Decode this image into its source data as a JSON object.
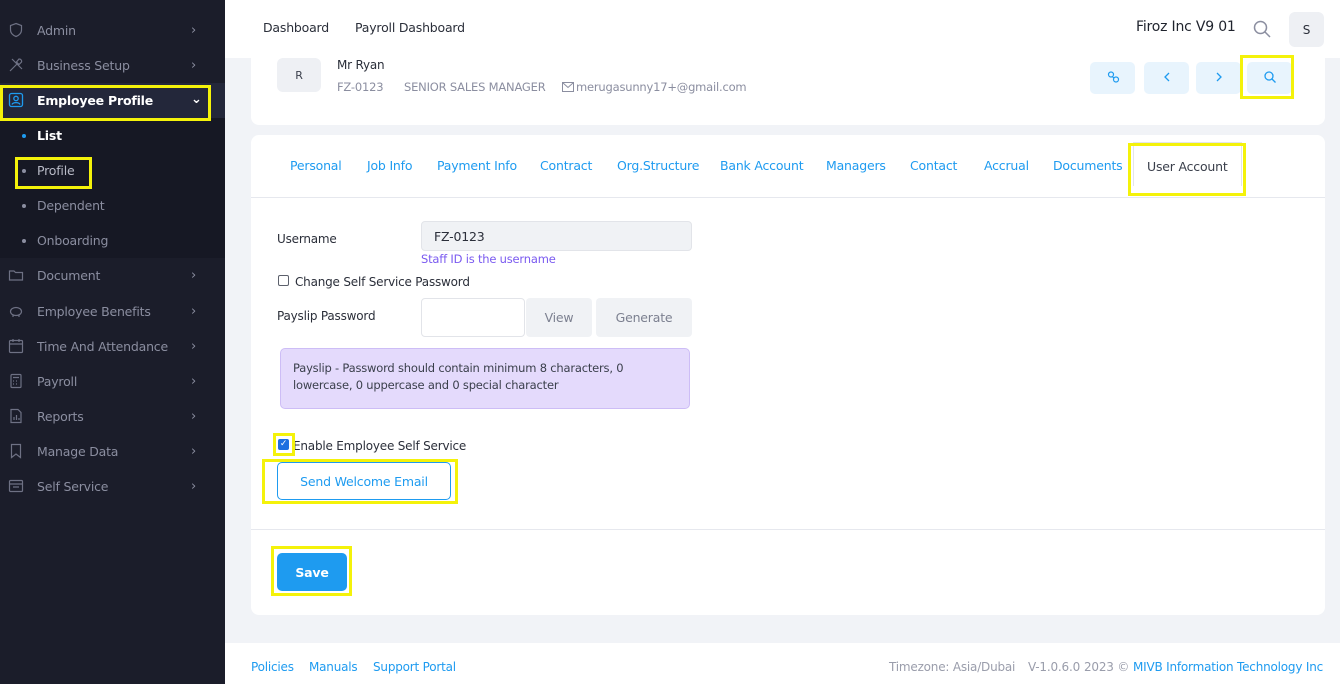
{
  "sidebar": {
    "items": [
      {
        "label": "Admin",
        "icon": "shield-icon"
      },
      {
        "label": "Business Setup",
        "icon": "tools-icon"
      },
      {
        "label": "Employee Profile",
        "icon": "user-card-icon"
      },
      {
        "label": "Document",
        "icon": "folder-icon"
      },
      {
        "label": "Employee Benefits",
        "icon": "piggy-bank-icon"
      },
      {
        "label": "Time And Attendance",
        "icon": "calendar-icon"
      },
      {
        "label": "Payroll",
        "icon": "calculator-icon"
      },
      {
        "label": "Reports",
        "icon": "report-icon"
      },
      {
        "label": "Manage Data",
        "icon": "bookmark-icon"
      },
      {
        "label": "Self Service",
        "icon": "inbox-icon"
      }
    ],
    "sub_items": [
      {
        "label": "List"
      },
      {
        "label": "Profile"
      },
      {
        "label": "Dependent"
      },
      {
        "label": "Onboarding"
      }
    ]
  },
  "header": {
    "links": [
      "Dashboard",
      "Payroll Dashboard"
    ],
    "company": "Firoz Inc V9 01",
    "avatar_initial": "S"
  },
  "employee": {
    "initial": "R",
    "name": "Mr Ryan",
    "staff_id": "FZ-0123",
    "title": "SENIOR SALES MANAGER",
    "email": "merugasunny17+@gmail.com"
  },
  "tabs": [
    "Personal",
    "Job Info",
    "Payment Info",
    "Contract",
    "Org.Structure",
    "Bank Account",
    "Managers",
    "Contact",
    "Accrual",
    "Documents",
    "User Account"
  ],
  "form": {
    "username_label": "Username",
    "username_value": "FZ-0123",
    "username_hint": "Staff ID is the username",
    "change_password_label": "Change Self Service Password",
    "change_password_checked": false,
    "payslip_label": "Payslip Password",
    "view_label": "View",
    "generate_label": "Generate",
    "notice": "Payslip - Password should contain minimum 8 characters, 0 lowercase, 0 uppercase and 0 special character",
    "enable_ess_label": "Enable Employee Self Service",
    "enable_ess_checked": true,
    "welcome_email_label": "Send Welcome Email",
    "save_label": "Save"
  },
  "footer": {
    "links": [
      "Policies",
      "Manuals",
      "Support Portal"
    ],
    "timezone": "Timezone: Asia/Dubai",
    "version": "V-1.0.6.0",
    "copyright": "2023 ©",
    "company_link": "MIVB Information Technology Inc"
  },
  "colors": {
    "accent": "#1e9bf0",
    "sidebar_bg": "#1b1d2a",
    "highlight": "#f4f20a",
    "notice_bg": "#e4dafc"
  }
}
